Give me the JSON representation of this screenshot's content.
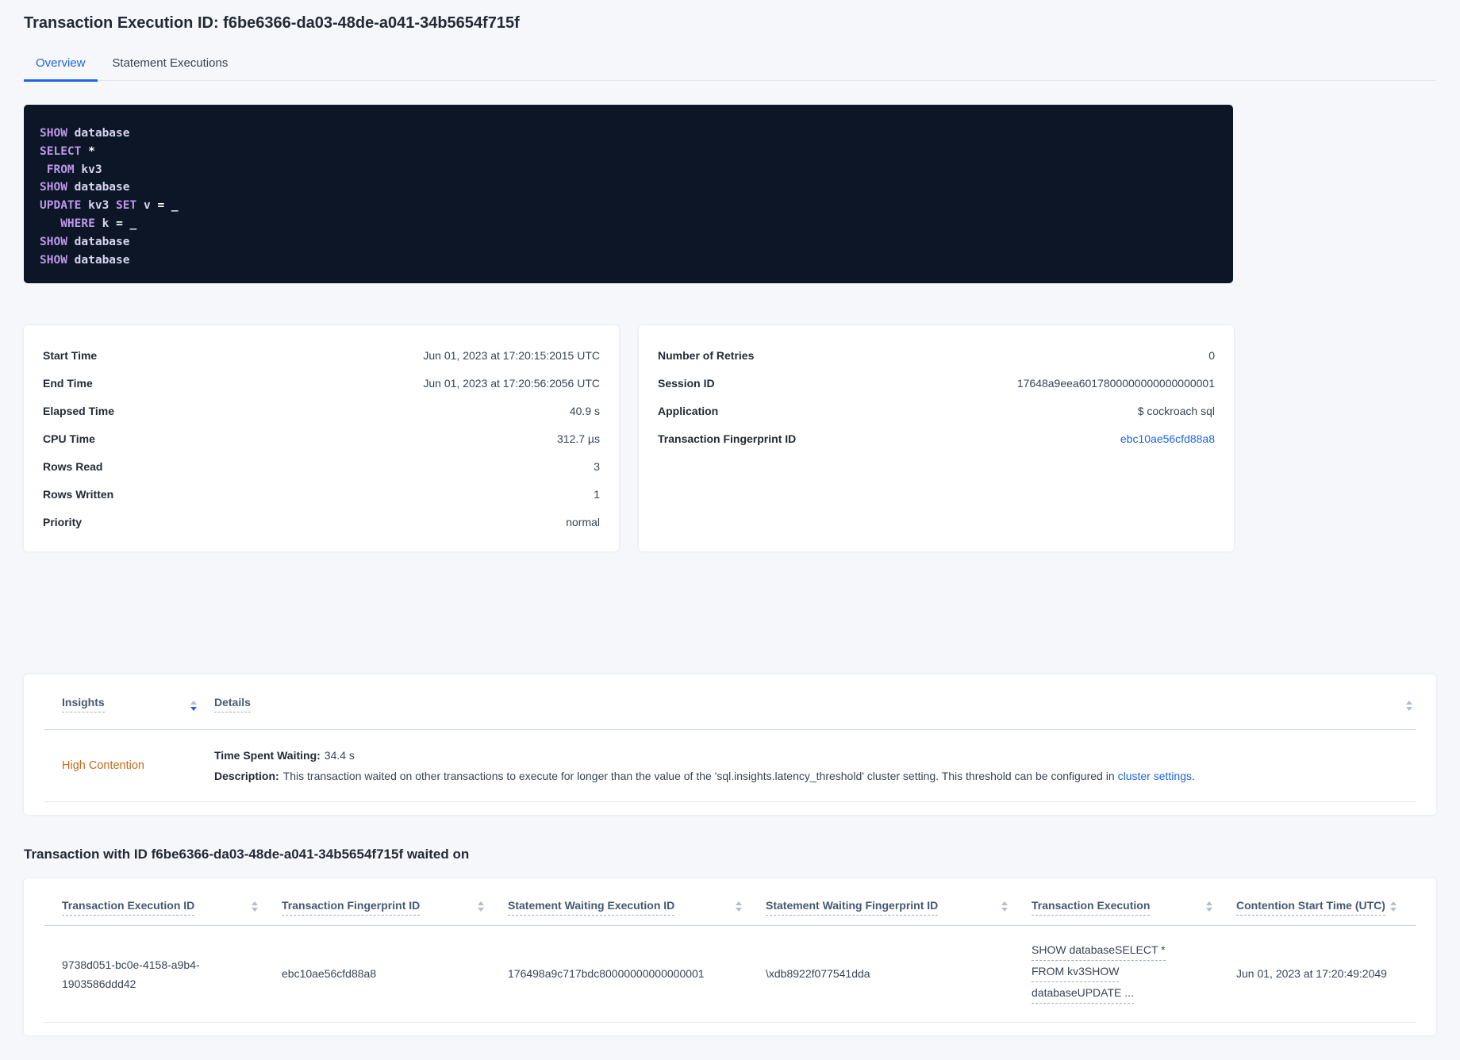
{
  "page": {
    "title": "Transaction Execution ID: f6be6366-da03-48de-a041-34b5654f715f"
  },
  "tabs": {
    "overview": "Overview",
    "statement_executions": "Statement Executions"
  },
  "sql": {
    "lines": [
      {
        "tokens": [
          {
            "text": "SHOW",
            "type": "kw"
          },
          {
            "text": " database",
            "type": "id"
          }
        ]
      },
      {
        "tokens": [
          {
            "text": "SELECT",
            "type": "kw"
          },
          {
            "text": " ",
            "type": "id"
          },
          {
            "text": "*",
            "type": "op"
          }
        ]
      },
      {
        "tokens": [
          {
            "text": " ",
            "type": "id"
          },
          {
            "text": "FROM",
            "type": "kw"
          },
          {
            "text": " kv3",
            "type": "id"
          }
        ]
      },
      {
        "tokens": [
          {
            "text": "SHOW",
            "type": "kw"
          },
          {
            "text": " database",
            "type": "id"
          }
        ]
      },
      {
        "tokens": [
          {
            "text": "UPDATE",
            "type": "kw"
          },
          {
            "text": " kv3 ",
            "type": "id"
          },
          {
            "text": "SET",
            "type": "kw"
          },
          {
            "text": " v ",
            "type": "id"
          },
          {
            "text": "= _",
            "type": "op"
          }
        ]
      },
      {
        "tokens": [
          {
            "text": "   ",
            "type": "id"
          },
          {
            "text": "WHERE",
            "type": "kw"
          },
          {
            "text": " k ",
            "type": "id"
          },
          {
            "text": "= _",
            "type": "op"
          }
        ]
      },
      {
        "tokens": [
          {
            "text": "SHOW",
            "type": "kw"
          },
          {
            "text": " database",
            "type": "id"
          }
        ]
      },
      {
        "tokens": [
          {
            "text": "SHOW",
            "type": "kw"
          },
          {
            "text": " database",
            "type": "id"
          }
        ]
      }
    ]
  },
  "summary_left": {
    "rows": [
      {
        "label": "Start Time",
        "value": "Jun 01, 2023 at 17:20:15:2015 UTC"
      },
      {
        "label": "End Time",
        "value": "Jun 01, 2023 at 17:20:56:2056 UTC"
      },
      {
        "label": "Elapsed Time",
        "value": "40.9 s"
      },
      {
        "label": "CPU Time",
        "value": "312.7 µs"
      },
      {
        "label": "Rows Read",
        "value": "3"
      },
      {
        "label": "Rows Written",
        "value": "1"
      },
      {
        "label": "Priority",
        "value": "normal"
      }
    ]
  },
  "summary_right": {
    "rows": [
      {
        "label": "Number of Retries",
        "value": "0"
      },
      {
        "label": "Session ID",
        "value": "17648a9eea6017800000000000000001"
      },
      {
        "label": "Application",
        "value": "$ cockroach sql"
      },
      {
        "label": "Transaction Fingerprint ID",
        "value": "ebc10ae56cfd88a8",
        "link": true
      }
    ]
  },
  "insights": {
    "col_insights": "Insights",
    "col_details": "Details",
    "row": {
      "insight": "High Contention",
      "waiting_label": "Time Spent Waiting:",
      "waiting_value": "34.4 s",
      "description_label": "Description:",
      "description_text": "This transaction waited on other transactions to execute for longer than the value of the 'sql.insights.latency_threshold' cluster setting. This threshold can be configured in",
      "description_link": "cluster settings",
      "description_suffix": "."
    }
  },
  "waited_on": {
    "heading": "Transaction with ID f6be6366-da03-48de-a041-34b5654f715f waited on",
    "columns": [
      "Transaction Execution ID",
      "Transaction Fingerprint ID",
      "Statement Waiting Execution ID",
      "Statement Waiting Fingerprint ID",
      "Transaction Execution",
      "Contention Start Time (UTC)"
    ],
    "rows": [
      {
        "cells": [
          {
            "type": "text",
            "value": "9738d051-bc0e-4158-a9b4-1903586ddd42"
          },
          {
            "type": "text",
            "value": "ebc10ae56cfd88a8"
          },
          {
            "type": "text",
            "value": "176498a9c717bdc80000000000000001"
          },
          {
            "type": "text",
            "value": "\\xdb8922f077541dda"
          },
          {
            "type": "link-lines",
            "lines": [
              "SHOW databaseSELECT *",
              "FROM kv3SHOW",
              "databaseUPDATE ..."
            ]
          },
          {
            "type": "text",
            "value": "Jun 01, 2023 at 17:20:49:2049"
          }
        ]
      }
    ]
  },
  "colors": {
    "accent_blue": "#2065e0",
    "insight_orange": "#c26a1f",
    "code_background": "#0c1627",
    "code_keyword": "#bd97e8",
    "code_identifier": "#d8d4f0",
    "code_operator": "#ffffff",
    "page_background": "#f5f7fa"
  }
}
